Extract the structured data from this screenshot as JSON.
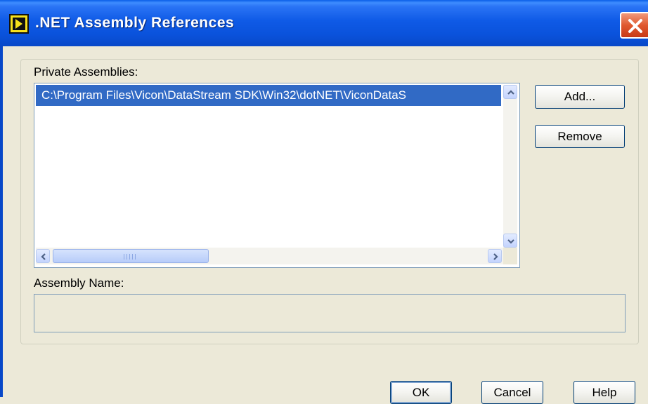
{
  "window": {
    "title": ".NET Assembly References",
    "icon": "labview-vi-icon",
    "close_icon": "close-icon"
  },
  "private_assemblies": {
    "label": "Private Assemblies:",
    "items": [
      {
        "path": "C:\\Program Files\\Vicon\\DataStream SDK\\Win32\\dotNET\\ViconDataS",
        "selected": true
      }
    ]
  },
  "buttons": {
    "add": "Add...",
    "remove": "Remove",
    "ok": "OK",
    "cancel": "Cancel",
    "help": "Help"
  },
  "assembly_name": {
    "label": "Assembly Name:",
    "value": ""
  },
  "colors": {
    "titlebar": "#0a52db",
    "selection": "#316ac5",
    "dialog_bg": "#ece9d8",
    "close_button": "#e0582f"
  }
}
